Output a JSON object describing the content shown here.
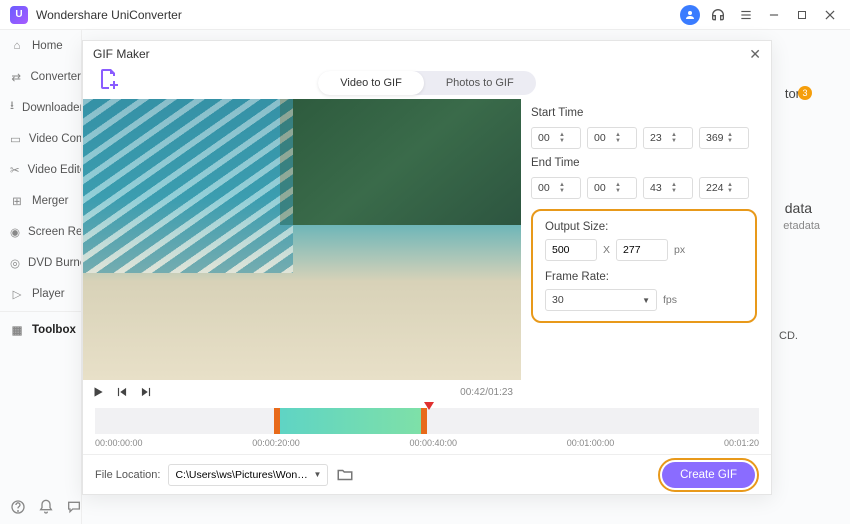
{
  "app": {
    "title": "Wondershare UniConverter"
  },
  "titlebar_icons": [
    "user",
    "headset",
    "menu",
    "minimize",
    "maximize",
    "close"
  ],
  "sidebar": {
    "items": [
      {
        "label": "Home"
      },
      {
        "label": "Converter"
      },
      {
        "label": "Downloader"
      },
      {
        "label": "Video Compressor"
      },
      {
        "label": "Video Editor"
      },
      {
        "label": "Merger"
      },
      {
        "label": "Screen Recorder"
      },
      {
        "label": "DVD Burner"
      },
      {
        "label": "Player"
      },
      {
        "label": "Toolbox"
      }
    ],
    "active_index": 9
  },
  "background": {
    "tag": "tor",
    "badge": "3",
    "meta_title": "data",
    "meta_sub": "etadata",
    "line": "CD."
  },
  "modal": {
    "title": "GIF Maker",
    "tabs": {
      "video": "Video to GIF",
      "photos": "Photos to GIF",
      "active": "video"
    },
    "playback": {
      "current": "00:42",
      "total": "01:23"
    },
    "start_label": "Start Time",
    "end_label": "End Time",
    "start": {
      "h": "00",
      "m": "00",
      "s": "23",
      "ms": "369"
    },
    "end": {
      "h": "00",
      "m": "00",
      "s": "43",
      "ms": "224"
    },
    "output": {
      "size_label": "Output Size:",
      "w": "500",
      "sep": "X",
      "h": "277",
      "unit": "px",
      "rate_label": "Frame Rate:",
      "rate": "30",
      "rate_unit": "fps"
    },
    "timeline": {
      "ticks": [
        "00:00:00:00",
        "00:00:20:00",
        "00:00:40:00",
        "00:01:00:00",
        "00:01:20"
      ]
    },
    "file": {
      "label": "File Location:",
      "path": "C:\\Users\\ws\\Pictures\\Wonders"
    },
    "create_label": "Create GIF"
  }
}
